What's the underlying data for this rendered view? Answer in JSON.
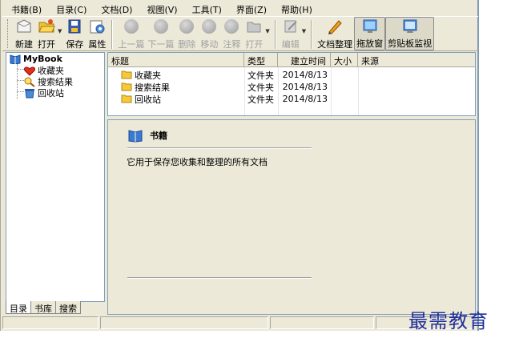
{
  "menubar": {
    "items": [
      {
        "label": "书籍(B)"
      },
      {
        "label": "目录(C)"
      },
      {
        "label": "文档(D)"
      },
      {
        "label": "视图(V)"
      },
      {
        "label": "工具(T)"
      },
      {
        "label": "界面(Z)"
      },
      {
        "label": "帮助(H)"
      }
    ]
  },
  "toolbar": {
    "new_label": "新建",
    "open_label": "打开",
    "save_label": "保存",
    "properties_label": "属性",
    "prev_label": "上一篇",
    "next_label": "下一篇",
    "delete_label": "删除",
    "move_label": "移动",
    "annotate_label": "注释",
    "open2_label": "打开",
    "edit_label": "编辑",
    "organize_label": "文档整理",
    "dragwin_label": "拖放窗",
    "clipboard_label": "剪贴板监视"
  },
  "tree": {
    "root": "MyBook",
    "children": [
      {
        "label": "收藏夹"
      },
      {
        "label": "搜索结果"
      },
      {
        "label": "回收站"
      }
    ]
  },
  "tabs": [
    {
      "label": "目录"
    },
    {
      "label": "书库"
    },
    {
      "label": "搜索"
    }
  ],
  "list": {
    "columns": [
      "标题",
      "类型",
      "建立时间",
      "大小",
      "来源"
    ],
    "rows": [
      {
        "title": "收藏夹",
        "type": "文件夹",
        "date": "2014/8/13",
        "size": "",
        "source": ""
      },
      {
        "title": "搜索结果",
        "type": "文件夹",
        "date": "2014/8/13",
        "size": "",
        "source": ""
      },
      {
        "title": "回收站",
        "type": "文件夹",
        "date": "2014/8/13",
        "size": "",
        "source": ""
      }
    ]
  },
  "detail": {
    "title": "书籍",
    "description": "它用于保存您收集和整理的所有文档"
  },
  "watermark": "最需教育",
  "colors": {
    "frame_bg": "#ece9d8",
    "border": "#7f9db9",
    "watermark": "#1f2f9c"
  }
}
